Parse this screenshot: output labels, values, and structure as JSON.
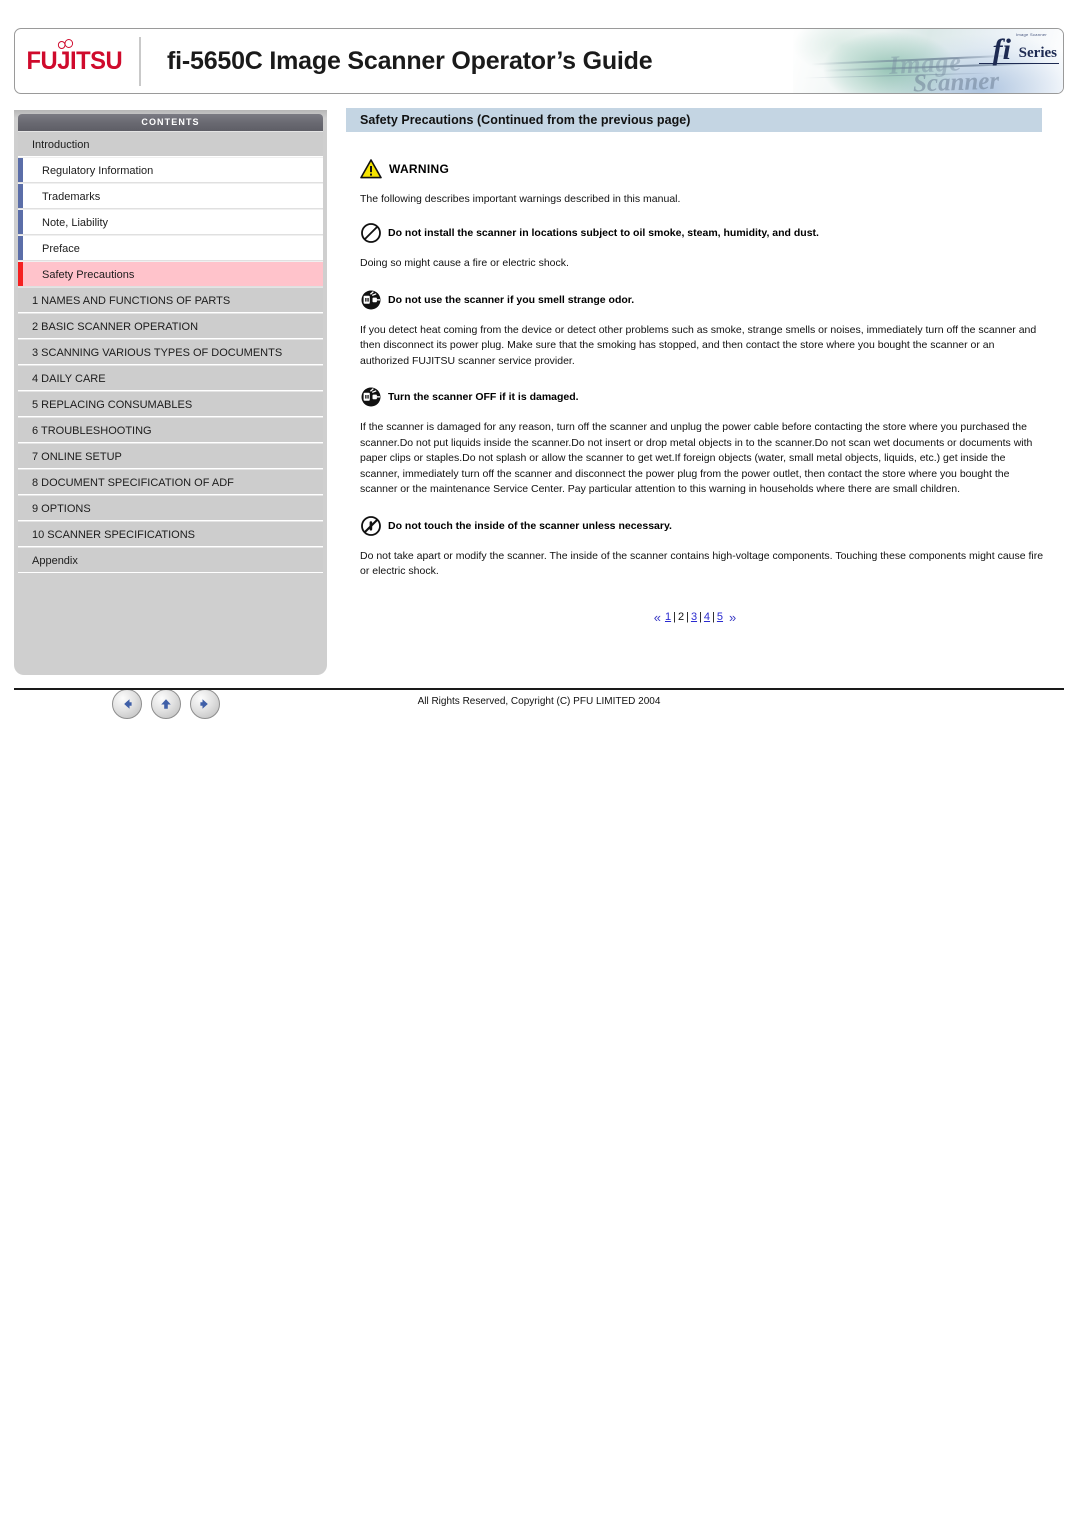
{
  "header": {
    "logo_text": "FUJITSU",
    "title": "fi-5650C Image Scanner Operator’s Guide",
    "banner": {
      "fi": "fi",
      "series": "Series",
      "word_image": "Image",
      "word_scanner": "Scanner",
      "tagline": "Image Scanner"
    }
  },
  "sidebar": {
    "heading": "CONTENTS",
    "items": [
      {
        "label": "Introduction",
        "level": "top",
        "selected": false
      },
      {
        "label": "Regulatory Information",
        "level": "sub",
        "selected": false
      },
      {
        "label": "Trademarks",
        "level": "sub",
        "selected": false
      },
      {
        "label": "Note, Liability",
        "level": "sub",
        "selected": false
      },
      {
        "label": "Preface",
        "level": "sub",
        "selected": false
      },
      {
        "label": "Safety Precautions",
        "level": "sub",
        "selected": true
      },
      {
        "label": "1 NAMES AND FUNCTIONS OF PARTS",
        "level": "top",
        "selected": false
      },
      {
        "label": "2 BASIC SCANNER OPERATION",
        "level": "top",
        "selected": false
      },
      {
        "label": "3 SCANNING VARIOUS TYPES OF DOCUMENTS",
        "level": "top",
        "selected": false
      },
      {
        "label": "4 DAILY CARE",
        "level": "top",
        "selected": false
      },
      {
        "label": "5 REPLACING CONSUMABLES",
        "level": "top",
        "selected": false
      },
      {
        "label": "6 TROUBLESHOOTING",
        "level": "top",
        "selected": false
      },
      {
        "label": "7 ONLINE SETUP",
        "level": "top",
        "selected": false
      },
      {
        "label": "8 DOCUMENT SPECIFICATION OF ADF",
        "level": "top",
        "selected": false
      },
      {
        "label": "9 OPTIONS",
        "level": "top",
        "selected": false
      },
      {
        "label": "10 SCANNER SPECIFICATIONS",
        "level": "top",
        "selected": false
      },
      {
        "label": "Appendix",
        "level": "top",
        "selected": false
      }
    ],
    "nav": [
      {
        "name": "back",
        "glyph": "←"
      },
      {
        "name": "up",
        "glyph": "↑"
      },
      {
        "name": "forward",
        "glyph": "→"
      }
    ]
  },
  "main": {
    "section_title": "Safety Precautions (Continued from the previous page)",
    "warning_label": "WARNING",
    "warning_icon": "warning-triangle-icon",
    "intro": "The following describes important warnings described in this manual.",
    "rules": [
      {
        "icon": "prohibition-circle-icon",
        "heading": "Do not install the scanner in locations subject to oil smoke, steam, humidity, and dust.",
        "body": "Doing so might cause a fire or electric shock."
      },
      {
        "icon": "unplug-power-icon",
        "heading": "Do not use the scanner if you smell strange odor.",
        "body": "If you detect heat coming from the device or detect other problems such as smoke, strange smells or noises, immediately turn off the scanner and then disconnect its power plug. Make sure that the smoking has stopped, and then contact the store where you bought the scanner or an authorized FUJITSU scanner service provider."
      },
      {
        "icon": "unplug-power-icon",
        "heading": "Turn the scanner OFF if it is damaged.",
        "body": "If the scanner is damaged for any reason, turn off the scanner and unplug the power cable before contacting the store where you purchased the scanner.Do not put liquids inside the scanner.Do not insert or drop metal objects in to the scanner.Do not scan wet documents or documents with paper clips or staples.Do not splash or allow the scanner to get wet.If foreign objects (water, small metal objects, liquids, etc.) get inside the scanner, immediately turn off the scanner and disconnect the power plug from the power outlet, then contact the store where you bought the scanner or the maintenance Service Center. Pay particular attention to this warning in households where there are small children."
      },
      {
        "icon": "do-not-touch-icon",
        "heading": "Do not touch the inside of the scanner unless necessary.",
        "body": "Do not take apart or modify the scanner. The inside of the scanner contains high-voltage components. Touching these components might cause fire or electric shock."
      }
    ],
    "pager": {
      "prev_glyph": "«",
      "next_glyph": "»",
      "separator": "|",
      "pages": [
        "1",
        "2",
        "3",
        "4",
        "5"
      ],
      "current": "2"
    }
  },
  "footer": {
    "copyright": "All Rights Reserved, Copyright (C) PFU LIMITED 2004"
  },
  "colors": {
    "fujitsu_red": "#cf0a2c",
    "section_bar": "#c4d5e3",
    "selected_row": "#ffc3cb",
    "selected_marker": "#f52020",
    "sub_marker": "#5b6ea8",
    "link": "#2a2ad0"
  }
}
